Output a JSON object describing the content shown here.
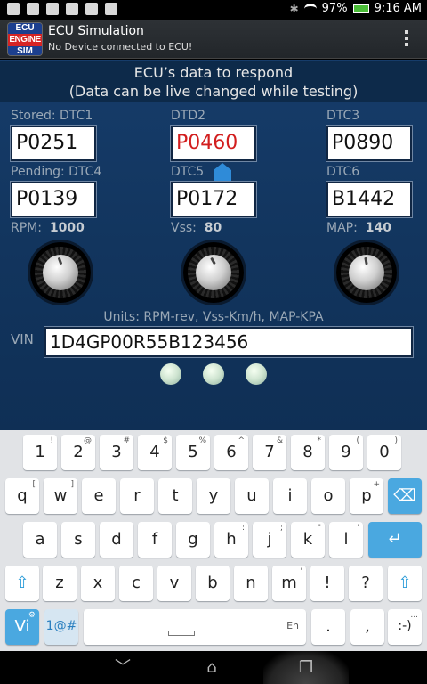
{
  "statusbar": {
    "battery": "97%",
    "time": "9:16 AM"
  },
  "app": {
    "logo_l1": "ECU",
    "logo_l2": "ENGINE",
    "logo_l3": "SIM",
    "title": "ECU Simulation",
    "subtitle": "No Device connected to ECU!"
  },
  "banner": {
    "line1": "ECU’s data to respond",
    "line2": "(Data can be live changed while testing)"
  },
  "dtc": {
    "stored_label": "Stored: DTC1",
    "dtc1": "P0251",
    "dtd2_label": "DTD2",
    "dtd2": "P0460",
    "dtc3_label": "DTC3",
    "dtc3": "P0890",
    "pending_label": "Pending: DTC4",
    "dtc4": "P0139",
    "dtc5_label": "DTC5",
    "dtc5": "P0172",
    "dtc6_label": "DTC6",
    "dtc6": "B1442"
  },
  "params": {
    "rpm_label": "RPM:",
    "rpm_value": "1000",
    "vss_label": "Vss:",
    "vss_value": "80",
    "map_label": "MAP:",
    "map_value": "140"
  },
  "units": "Units: RPM-rev, Vss-Km/h, MAP-KPA",
  "vin": {
    "label": "VIN",
    "value": "1D4GP00R55B123456"
  },
  "keyboard": {
    "row1": [
      [
        "1",
        "!"
      ],
      [
        "2",
        "@"
      ],
      [
        "3",
        "#"
      ],
      [
        "4",
        "$"
      ],
      [
        "5",
        "%"
      ],
      [
        "6",
        "^"
      ],
      [
        "7",
        "&"
      ],
      [
        "8",
        "*"
      ],
      [
        "9",
        "("
      ],
      [
        "0",
        ")"
      ]
    ],
    "row2": [
      [
        "q",
        "["
      ],
      [
        "w",
        "]"
      ],
      [
        "e",
        ""
      ],
      [
        "r",
        ""
      ],
      [
        "t",
        ""
      ],
      [
        "y",
        ""
      ],
      [
        "u",
        ""
      ],
      [
        "i",
        ""
      ],
      [
        "o",
        ""
      ],
      [
        "p",
        "+"
      ]
    ],
    "row3": [
      [
        "a",
        ""
      ],
      [
        "s",
        ""
      ],
      [
        "d",
        ""
      ],
      [
        "f",
        ""
      ],
      [
        "g",
        ""
      ],
      [
        "h",
        ":"
      ],
      [
        "j",
        ";"
      ],
      [
        "k",
        "\""
      ],
      [
        "l",
        "'"
      ]
    ],
    "row4": [
      [
        "z",
        ""
      ],
      [
        "x",
        ""
      ],
      [
        "c",
        ""
      ],
      [
        "v",
        ""
      ],
      [
        "b",
        ""
      ],
      [
        "n",
        ""
      ],
      [
        "m",
        "'"
      ],
      [
        "!",
        ""
      ],
      [
        "?",
        ""
      ]
    ],
    "vi": "Vi",
    "sym": "1@#",
    "space_lang": "En",
    "period": ".",
    "emoticon": ":-)",
    "ellipsis": "..."
  }
}
